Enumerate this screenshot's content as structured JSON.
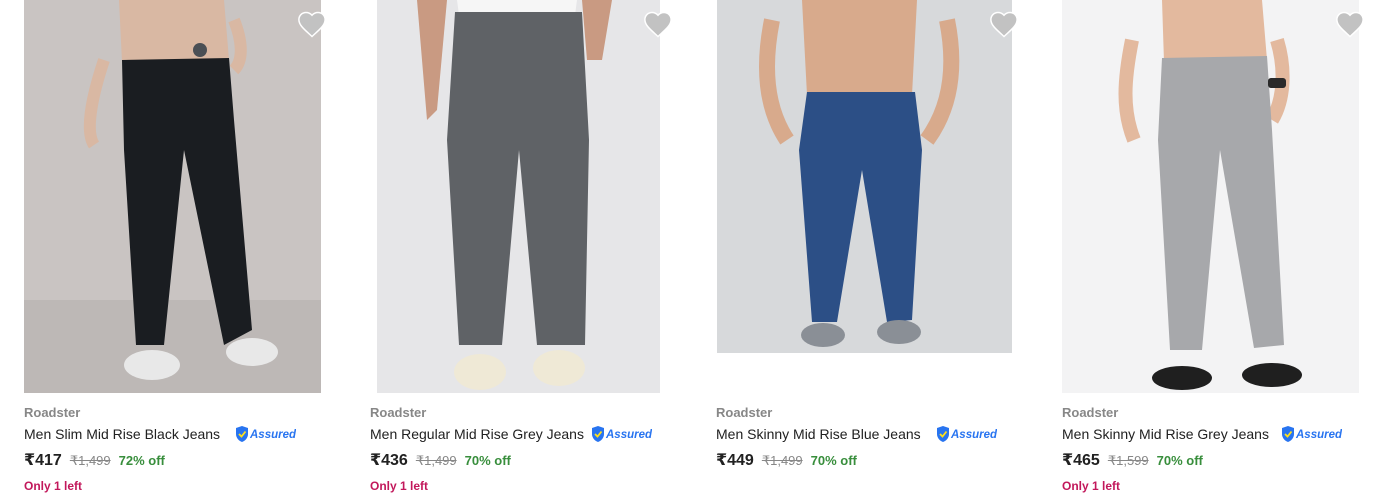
{
  "products": [
    {
      "brand": "Roadster",
      "title": "Men Slim Mid Rise Black Jeans",
      "price": "₹417",
      "mrp": "₹1,499",
      "discount": "72% off",
      "stock": "Only 1 left",
      "assured": "Assured",
      "jeans_color": "#1a1d21",
      "image_bg": "#c9c4c2"
    },
    {
      "brand": "Roadster",
      "title": "Men Regular Mid Rise Grey Jeans",
      "price": "₹436",
      "mrp": "₹1,499",
      "discount": "70% off",
      "stock": "Only 1 left",
      "assured": "Assured",
      "jeans_color": "#5f6266",
      "image_bg": "#e6e6e8"
    },
    {
      "brand": "Roadster",
      "title": "Men Skinny Mid Rise Blue Jeans",
      "price": "₹449",
      "mrp": "₹1,499",
      "discount": "70% off",
      "stock": "",
      "assured": "Assured",
      "jeans_color": "#2c4f86",
      "image_bg": "#d7d9db"
    },
    {
      "brand": "Roadster",
      "title": "Men Skinny Mid Rise Grey Jeans",
      "price": "₹465",
      "mrp": "₹1,599",
      "discount": "70% off",
      "stock": "Only 1 left",
      "assured": "Assured",
      "jeans_color": "#a7a8ab",
      "image_bg": "#f3f3f4"
    }
  ],
  "colors": {
    "discount": "#388e3c",
    "stock": "#c2185b",
    "assured_blue": "#2874f0",
    "wishlist": "#c2c2c2"
  },
  "icons": {
    "wishlist": "heart-icon",
    "assured": "assured-shield-icon"
  }
}
